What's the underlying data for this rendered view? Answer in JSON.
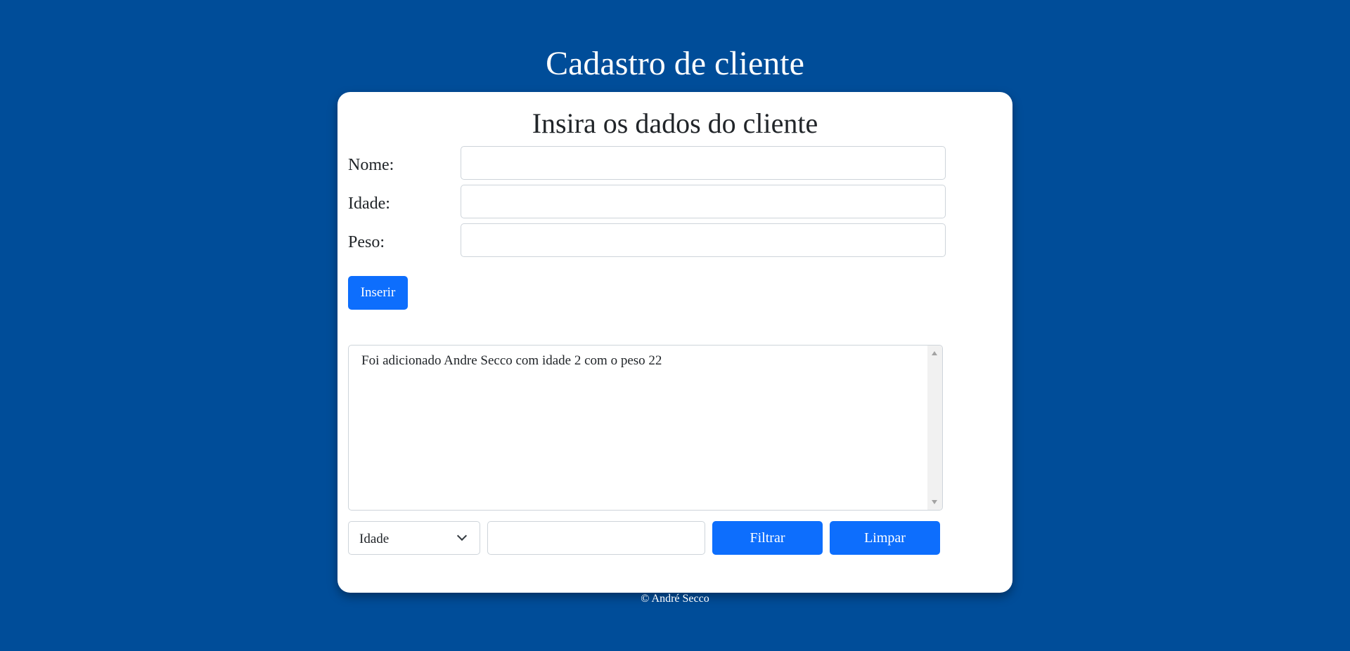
{
  "header": {
    "title": "Cadastro de cliente"
  },
  "form": {
    "title": "Insira os dados do cliente",
    "fields": [
      {
        "label": "Nome:",
        "value": ""
      },
      {
        "label": "Idade:",
        "value": ""
      },
      {
        "label": "Peso:",
        "value": ""
      }
    ],
    "insert_label": "Inserir"
  },
  "log": {
    "text": "Foi adicionado Andre Secco com idade 2 com o peso 22"
  },
  "filter": {
    "selected": "Idade",
    "value": "",
    "filter_label": "Filtrar",
    "clear_label": "Limpar"
  },
  "footer": {
    "text": "© André Secco"
  }
}
